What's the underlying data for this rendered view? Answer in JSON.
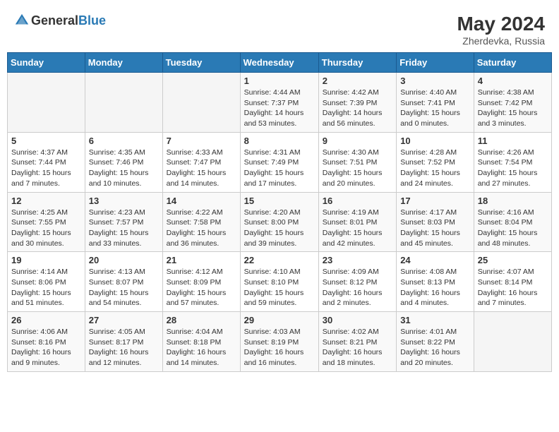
{
  "header": {
    "logo_general": "General",
    "logo_blue": "Blue",
    "title": "May 2024",
    "subtitle": "Zherdevka, Russia"
  },
  "weekdays": [
    "Sunday",
    "Monday",
    "Tuesday",
    "Wednesday",
    "Thursday",
    "Friday",
    "Saturday"
  ],
  "weeks": [
    [
      {
        "day": "",
        "content": ""
      },
      {
        "day": "",
        "content": ""
      },
      {
        "day": "",
        "content": ""
      },
      {
        "day": "1",
        "content": "Sunrise: 4:44 AM\nSunset: 7:37 PM\nDaylight: 14 hours and 53 minutes."
      },
      {
        "day": "2",
        "content": "Sunrise: 4:42 AM\nSunset: 7:39 PM\nDaylight: 14 hours and 56 minutes."
      },
      {
        "day": "3",
        "content": "Sunrise: 4:40 AM\nSunset: 7:41 PM\nDaylight: 15 hours and 0 minutes."
      },
      {
        "day": "4",
        "content": "Sunrise: 4:38 AM\nSunset: 7:42 PM\nDaylight: 15 hours and 3 minutes."
      }
    ],
    [
      {
        "day": "5",
        "content": "Sunrise: 4:37 AM\nSunset: 7:44 PM\nDaylight: 15 hours and 7 minutes."
      },
      {
        "day": "6",
        "content": "Sunrise: 4:35 AM\nSunset: 7:46 PM\nDaylight: 15 hours and 10 minutes."
      },
      {
        "day": "7",
        "content": "Sunrise: 4:33 AM\nSunset: 7:47 PM\nDaylight: 15 hours and 14 minutes."
      },
      {
        "day": "8",
        "content": "Sunrise: 4:31 AM\nSunset: 7:49 PM\nDaylight: 15 hours and 17 minutes."
      },
      {
        "day": "9",
        "content": "Sunrise: 4:30 AM\nSunset: 7:51 PM\nDaylight: 15 hours and 20 minutes."
      },
      {
        "day": "10",
        "content": "Sunrise: 4:28 AM\nSunset: 7:52 PM\nDaylight: 15 hours and 24 minutes."
      },
      {
        "day": "11",
        "content": "Sunrise: 4:26 AM\nSunset: 7:54 PM\nDaylight: 15 hours and 27 minutes."
      }
    ],
    [
      {
        "day": "12",
        "content": "Sunrise: 4:25 AM\nSunset: 7:55 PM\nDaylight: 15 hours and 30 minutes."
      },
      {
        "day": "13",
        "content": "Sunrise: 4:23 AM\nSunset: 7:57 PM\nDaylight: 15 hours and 33 minutes."
      },
      {
        "day": "14",
        "content": "Sunrise: 4:22 AM\nSunset: 7:58 PM\nDaylight: 15 hours and 36 minutes."
      },
      {
        "day": "15",
        "content": "Sunrise: 4:20 AM\nSunset: 8:00 PM\nDaylight: 15 hours and 39 minutes."
      },
      {
        "day": "16",
        "content": "Sunrise: 4:19 AM\nSunset: 8:01 PM\nDaylight: 15 hours and 42 minutes."
      },
      {
        "day": "17",
        "content": "Sunrise: 4:17 AM\nSunset: 8:03 PM\nDaylight: 15 hours and 45 minutes."
      },
      {
        "day": "18",
        "content": "Sunrise: 4:16 AM\nSunset: 8:04 PM\nDaylight: 15 hours and 48 minutes."
      }
    ],
    [
      {
        "day": "19",
        "content": "Sunrise: 4:14 AM\nSunset: 8:06 PM\nDaylight: 15 hours and 51 minutes."
      },
      {
        "day": "20",
        "content": "Sunrise: 4:13 AM\nSunset: 8:07 PM\nDaylight: 15 hours and 54 minutes."
      },
      {
        "day": "21",
        "content": "Sunrise: 4:12 AM\nSunset: 8:09 PM\nDaylight: 15 hours and 57 minutes."
      },
      {
        "day": "22",
        "content": "Sunrise: 4:10 AM\nSunset: 8:10 PM\nDaylight: 15 hours and 59 minutes."
      },
      {
        "day": "23",
        "content": "Sunrise: 4:09 AM\nSunset: 8:12 PM\nDaylight: 16 hours and 2 minutes."
      },
      {
        "day": "24",
        "content": "Sunrise: 4:08 AM\nSunset: 8:13 PM\nDaylight: 16 hours and 4 minutes."
      },
      {
        "day": "25",
        "content": "Sunrise: 4:07 AM\nSunset: 8:14 PM\nDaylight: 16 hours and 7 minutes."
      }
    ],
    [
      {
        "day": "26",
        "content": "Sunrise: 4:06 AM\nSunset: 8:16 PM\nDaylight: 16 hours and 9 minutes."
      },
      {
        "day": "27",
        "content": "Sunrise: 4:05 AM\nSunset: 8:17 PM\nDaylight: 16 hours and 12 minutes."
      },
      {
        "day": "28",
        "content": "Sunrise: 4:04 AM\nSunset: 8:18 PM\nDaylight: 16 hours and 14 minutes."
      },
      {
        "day": "29",
        "content": "Sunrise: 4:03 AM\nSunset: 8:19 PM\nDaylight: 16 hours and 16 minutes."
      },
      {
        "day": "30",
        "content": "Sunrise: 4:02 AM\nSunset: 8:21 PM\nDaylight: 16 hours and 18 minutes."
      },
      {
        "day": "31",
        "content": "Sunrise: 4:01 AM\nSunset: 8:22 PM\nDaylight: 16 hours and 20 minutes."
      },
      {
        "day": "",
        "content": ""
      }
    ]
  ]
}
